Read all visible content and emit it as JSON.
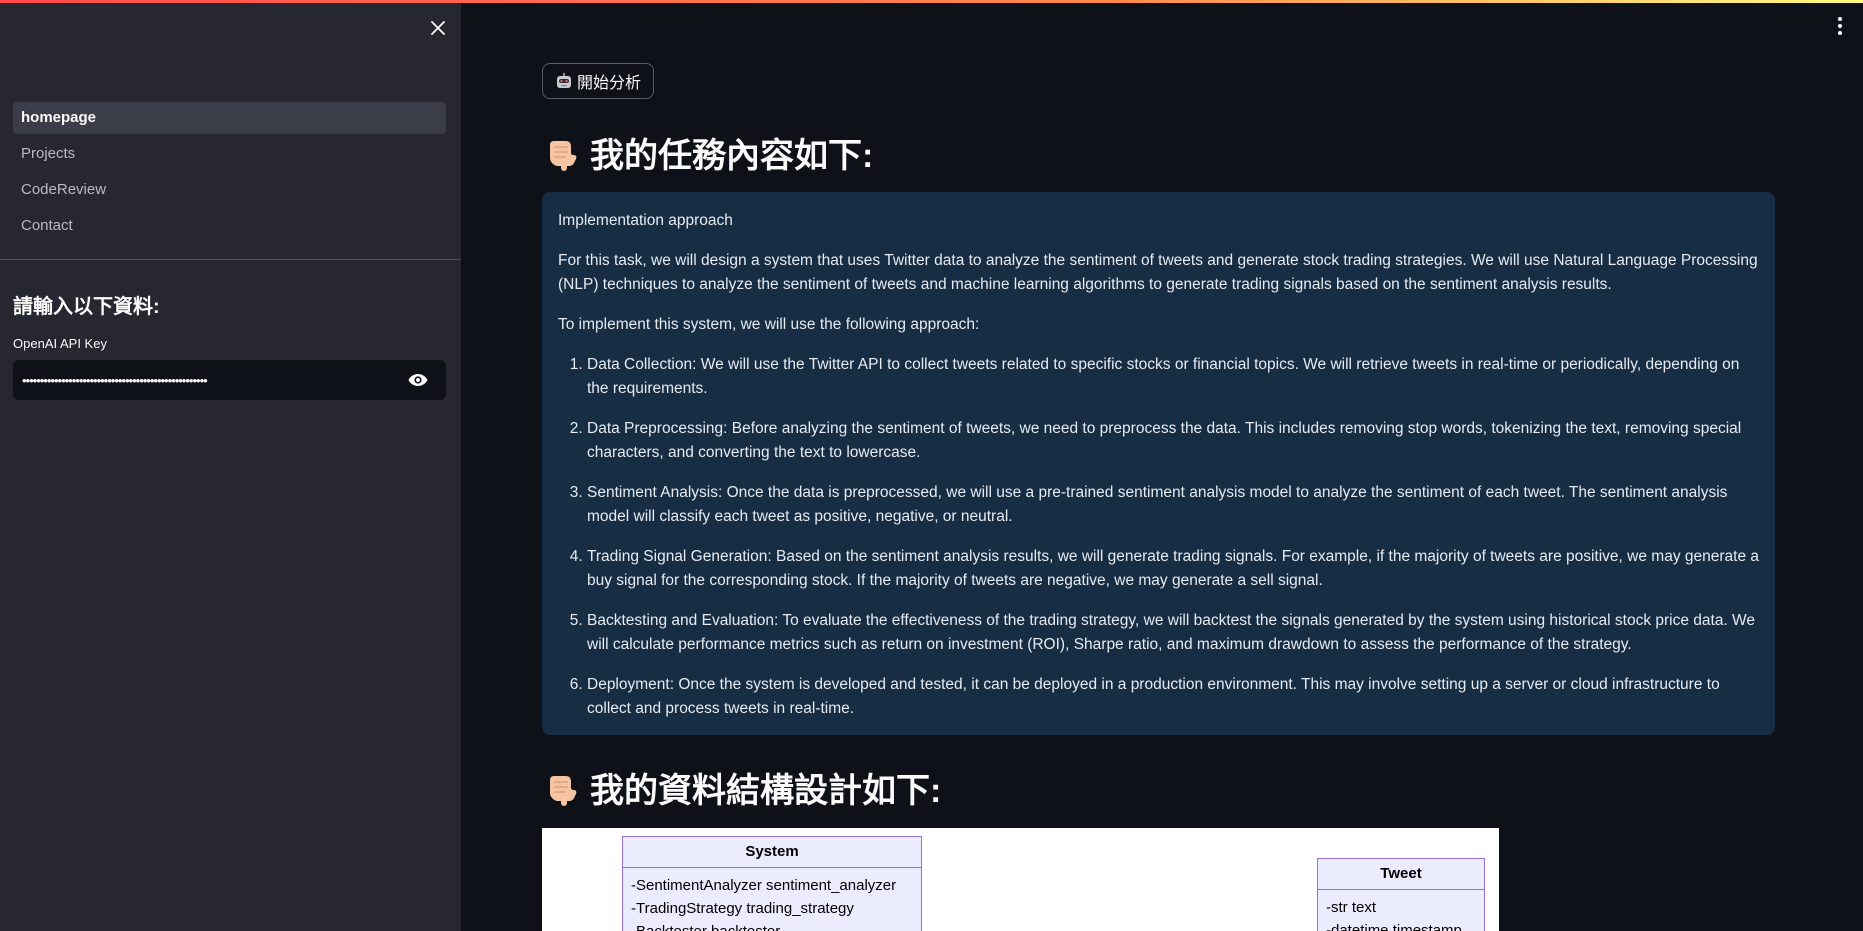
{
  "sidebar": {
    "close_label": "✕",
    "nav_items": [
      {
        "label": "homepage",
        "active": true
      },
      {
        "label": "Projects",
        "active": false
      },
      {
        "label": "CodeReview",
        "active": false
      },
      {
        "label": "Contact",
        "active": false
      }
    ],
    "heading": "請輸入以下資料:",
    "api_key_label": "OpenAI API Key",
    "api_key_value": "••••••••••••••••••••••••••••••••••••••••••••••••••••"
  },
  "main": {
    "start_button_label": "開始分析",
    "task_title": "我的任務內容如下:",
    "task": {
      "heading": "Implementation approach",
      "intro": "For this task, we will design a system that uses Twitter data to analyze the sentiment of tweets and generate stock trading strategies. We will use Natural Language Processing (NLP) techniques to analyze the sentiment of tweets and machine learning algorithms to generate trading signals based on the sentiment analysis results.",
      "lead": "To implement this system, we will use the following approach:",
      "steps": [
        "Data Collection: We will use the Twitter API to collect tweets related to specific stocks or financial topics. We will retrieve tweets in real-time or periodically, depending on the requirements.",
        "Data Preprocessing: Before analyzing the sentiment of tweets, we need to preprocess the data. This includes removing stop words, tokenizing the text, removing special characters, and converting the text to lowercase.",
        "Sentiment Analysis: Once the data is preprocessed, we will use a pre-trained sentiment analysis model to analyze the sentiment of each tweet. The sentiment analysis model will classify each tweet as positive, negative, or neutral.",
        "Trading Signal Generation: Based on the sentiment analysis results, we will generate trading signals. For example, if the majority of tweets are positive, we may generate a buy signal for the corresponding stock. If the majority of tweets are negative, we may generate a sell signal.",
        "Backtesting and Evaluation: To evaluate the effectiveness of the trading strategy, we will backtest the signals generated by the system using historical stock price data. We will calculate performance metrics such as return on investment (ROI), Sharpe ratio, and maximum drawdown to assess the performance of the strategy.",
        "Deployment: Once the system is developed and tested, it can be deployed in a production environment. This may involve setting up a server or cloud infrastructure to collect and process tweets in real-time."
      ]
    },
    "data_title": "我的資料結構設計如下:",
    "diagram": {
      "system_class": {
        "name": "System",
        "attrs": [
          "-SentimentAnalyzer sentiment_analyzer",
          "-TradingStrategy trading_strategy",
          "-Backtester backtester"
        ]
      },
      "tweet_class": {
        "name": "Tweet",
        "attrs": [
          "-str text",
          "-datetime timestamp"
        ]
      }
    }
  },
  "colors": {
    "background": "#0e1117",
    "sidebar": "#262730",
    "info_box": "#172d43",
    "accent": "#ff4b4b"
  }
}
